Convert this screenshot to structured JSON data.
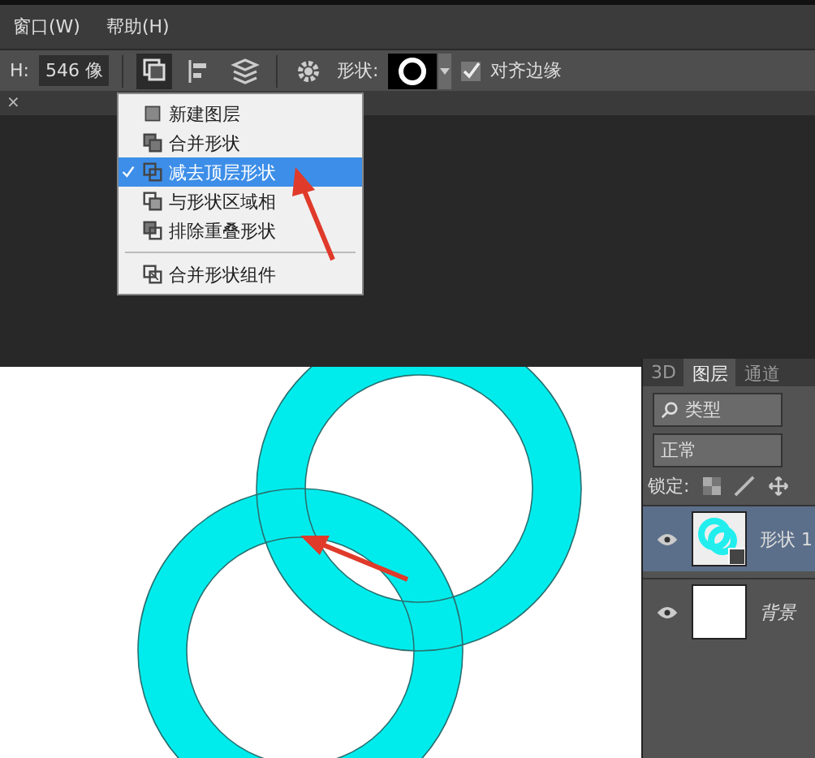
{
  "menubar": {
    "items": [
      "窗口(W)",
      "帮助(H)"
    ]
  },
  "options_bar": {
    "height_label": "H:",
    "height_value": "546 像",
    "path_ops_open": true,
    "shape_label": "形状:",
    "align_edges": {
      "label": "对齐边缘",
      "checked": true
    }
  },
  "document_tab": {
    "close": "×"
  },
  "path_ops_menu": {
    "groups": [
      [
        {
          "label": "新建图层",
          "kind": "new",
          "checked": false,
          "selected": false
        },
        {
          "label": "合并形状",
          "kind": "combine",
          "checked": false,
          "selected": false
        },
        {
          "label": "减去顶层形状",
          "kind": "subtract",
          "checked": true,
          "selected": true
        },
        {
          "label": "与形状区域相",
          "kind": "intersect",
          "checked": false,
          "selected": false
        },
        {
          "label": "排除重叠形状",
          "kind": "exclude",
          "checked": false,
          "selected": false
        }
      ],
      [
        {
          "label": "合并形状组件",
          "kind": "merge",
          "checked": false,
          "selected": false
        }
      ]
    ]
  },
  "layers_panel": {
    "tabs": [
      {
        "label": "3D",
        "selected": false
      },
      {
        "label": "图层",
        "selected": true
      },
      {
        "label": "通道",
        "selected": false
      }
    ],
    "filter": "类型",
    "blend_mode": "正常",
    "lock_label": "锁定:",
    "layers": [
      {
        "name": "形状 1",
        "kind": "shape",
        "selected": true,
        "visible": true
      },
      {
        "name": "背景",
        "kind": "background",
        "selected": false,
        "visible": true
      }
    ]
  }
}
